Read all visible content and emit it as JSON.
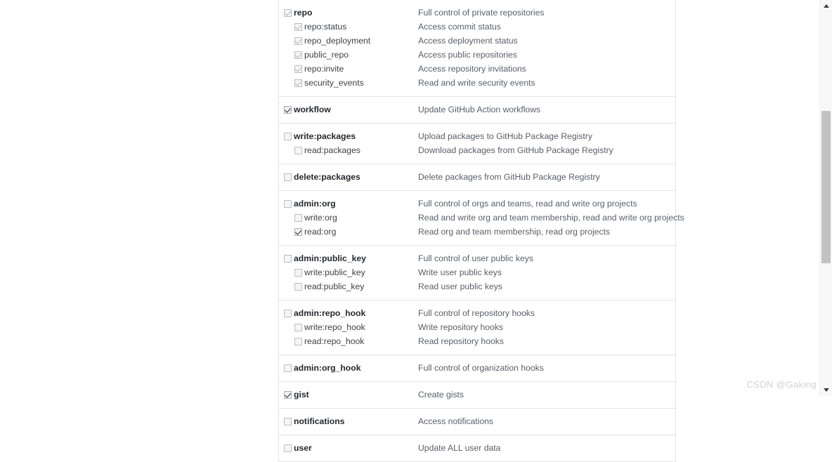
{
  "watermark": {
    "text": "CSDN @Gaking"
  },
  "scrollbar": {
    "up_arrow": "scroll-up-arrow",
    "down_arrow": "scroll-down-arrow",
    "thumb": "scroll-thumb"
  },
  "colors": {
    "panel_border": "#e1e4e8",
    "scope_name": "#24292e",
    "scope_desc": "#586069",
    "checkbox_border": "#b9bdc2",
    "checkbox_bg": "#f4f5f6",
    "check_active": "#24292e",
    "check_disabled": "#b4b8bc",
    "scrollbar_track": "#f8f8f8",
    "scrollbar_thumb": "#c2c2c2",
    "watermark": "#d2d2d2",
    "page_bg": "#ffffff"
  },
  "scopes_panel": {
    "groups": [
      {
        "rows": [
          {
            "name": "repo",
            "desc": "Full control of private repositories",
            "checked": true,
            "disabled": true,
            "child": false
          },
          {
            "name": "repo:status",
            "desc": "Access commit status",
            "checked": true,
            "disabled": true,
            "child": true
          },
          {
            "name": "repo_deployment",
            "desc": "Access deployment status",
            "checked": true,
            "disabled": true,
            "child": true
          },
          {
            "name": "public_repo",
            "desc": "Access public repositories",
            "checked": true,
            "disabled": true,
            "child": true
          },
          {
            "name": "repo:invite",
            "desc": "Access repository invitations",
            "checked": true,
            "disabled": true,
            "child": true
          },
          {
            "name": "security_events",
            "desc": "Read and write security events",
            "checked": true,
            "disabled": true,
            "child": true
          }
        ]
      },
      {
        "rows": [
          {
            "name": "workflow",
            "desc": "Update GitHub Action workflows",
            "checked": true,
            "disabled": false,
            "child": false
          }
        ]
      },
      {
        "rows": [
          {
            "name": "write:packages",
            "desc": "Upload packages to GitHub Package Registry",
            "checked": false,
            "disabled": false,
            "child": false
          },
          {
            "name": "read:packages",
            "desc": "Download packages from GitHub Package Registry",
            "checked": false,
            "disabled": false,
            "child": true
          }
        ]
      },
      {
        "rows": [
          {
            "name": "delete:packages",
            "desc": "Delete packages from GitHub Package Registry",
            "checked": false,
            "disabled": false,
            "child": false
          }
        ]
      },
      {
        "rows": [
          {
            "name": "admin:org",
            "desc": "Full control of orgs and teams, read and write org projects",
            "checked": false,
            "disabled": false,
            "child": false
          },
          {
            "name": "write:org",
            "desc": "Read and write org and team membership, read and write org projects",
            "checked": false,
            "disabled": false,
            "child": true
          },
          {
            "name": "read:org",
            "desc": "Read org and team membership, read org projects",
            "checked": true,
            "disabled": false,
            "child": true
          }
        ]
      },
      {
        "rows": [
          {
            "name": "admin:public_key",
            "desc": "Full control of user public keys",
            "checked": false,
            "disabled": false,
            "child": false
          },
          {
            "name": "write:public_key",
            "desc": "Write user public keys",
            "checked": false,
            "disabled": false,
            "child": true
          },
          {
            "name": "read:public_key",
            "desc": "Read user public keys",
            "checked": false,
            "disabled": false,
            "child": true
          }
        ]
      },
      {
        "rows": [
          {
            "name": "admin:repo_hook",
            "desc": "Full control of repository hooks",
            "checked": false,
            "disabled": false,
            "child": false
          },
          {
            "name": "write:repo_hook",
            "desc": "Write repository hooks",
            "checked": false,
            "disabled": false,
            "child": true
          },
          {
            "name": "read:repo_hook",
            "desc": "Read repository hooks",
            "checked": false,
            "disabled": false,
            "child": true
          }
        ]
      },
      {
        "rows": [
          {
            "name": "admin:org_hook",
            "desc": "Full control of organization hooks",
            "checked": false,
            "disabled": false,
            "child": false
          }
        ]
      },
      {
        "rows": [
          {
            "name": "gist",
            "desc": "Create gists",
            "checked": true,
            "disabled": false,
            "child": false
          }
        ]
      },
      {
        "rows": [
          {
            "name": "notifications",
            "desc": "Access notifications",
            "checked": false,
            "disabled": false,
            "child": false
          }
        ]
      },
      {
        "rows": [
          {
            "name": "user",
            "desc": "Update ALL user data",
            "checked": false,
            "disabled": false,
            "child": false
          }
        ]
      }
    ]
  }
}
